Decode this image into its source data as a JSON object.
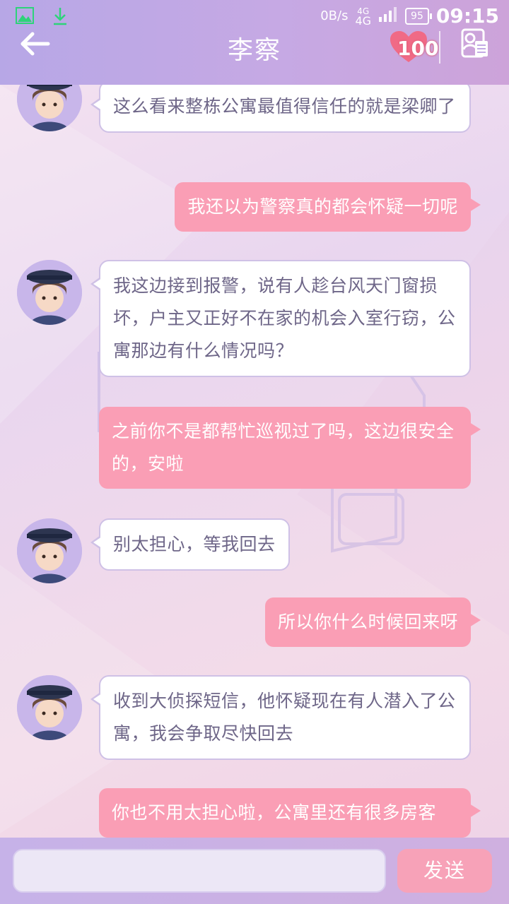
{
  "status_bar": {
    "net_speed": "0B/s",
    "signal_small": "4G",
    "signal_label": "4G",
    "battery": "95",
    "time": "09:15"
  },
  "header": {
    "title": "李察",
    "affection": "100"
  },
  "messages": [
    {
      "side": "left",
      "text": "这么看来整栋公寓最值得信任的就是梁卿了"
    },
    {
      "side": "right",
      "text": "我还以为警察真的都会怀疑一切呢"
    },
    {
      "side": "left",
      "text": "我这边接到报警，说有人趁台风天门窗损坏，户主又正好不在家的机会入室行窃，公寓那边有什么情况吗？"
    },
    {
      "side": "right",
      "text": "之前你不是都帮忙巡视过了吗，这边很安全的，安啦"
    },
    {
      "side": "left",
      "text": "别太担心，等我回去"
    },
    {
      "side": "right",
      "text": "所以你什么时候回来呀"
    },
    {
      "side": "left",
      "text": "收到大侦探短信，他怀疑现在有人潜入了公寓，我会争取尽快回去"
    },
    {
      "side": "right",
      "text": "你也不用太担心啦，公寓里还有很多房客"
    }
  ],
  "input": {
    "value": "",
    "placeholder": ""
  },
  "send_label": "发送",
  "colors": {
    "header": "#c3a9e5",
    "bubble_right": "#fa9eb5",
    "bubble_left": "#ffffff",
    "text_left": "#6e6688"
  }
}
